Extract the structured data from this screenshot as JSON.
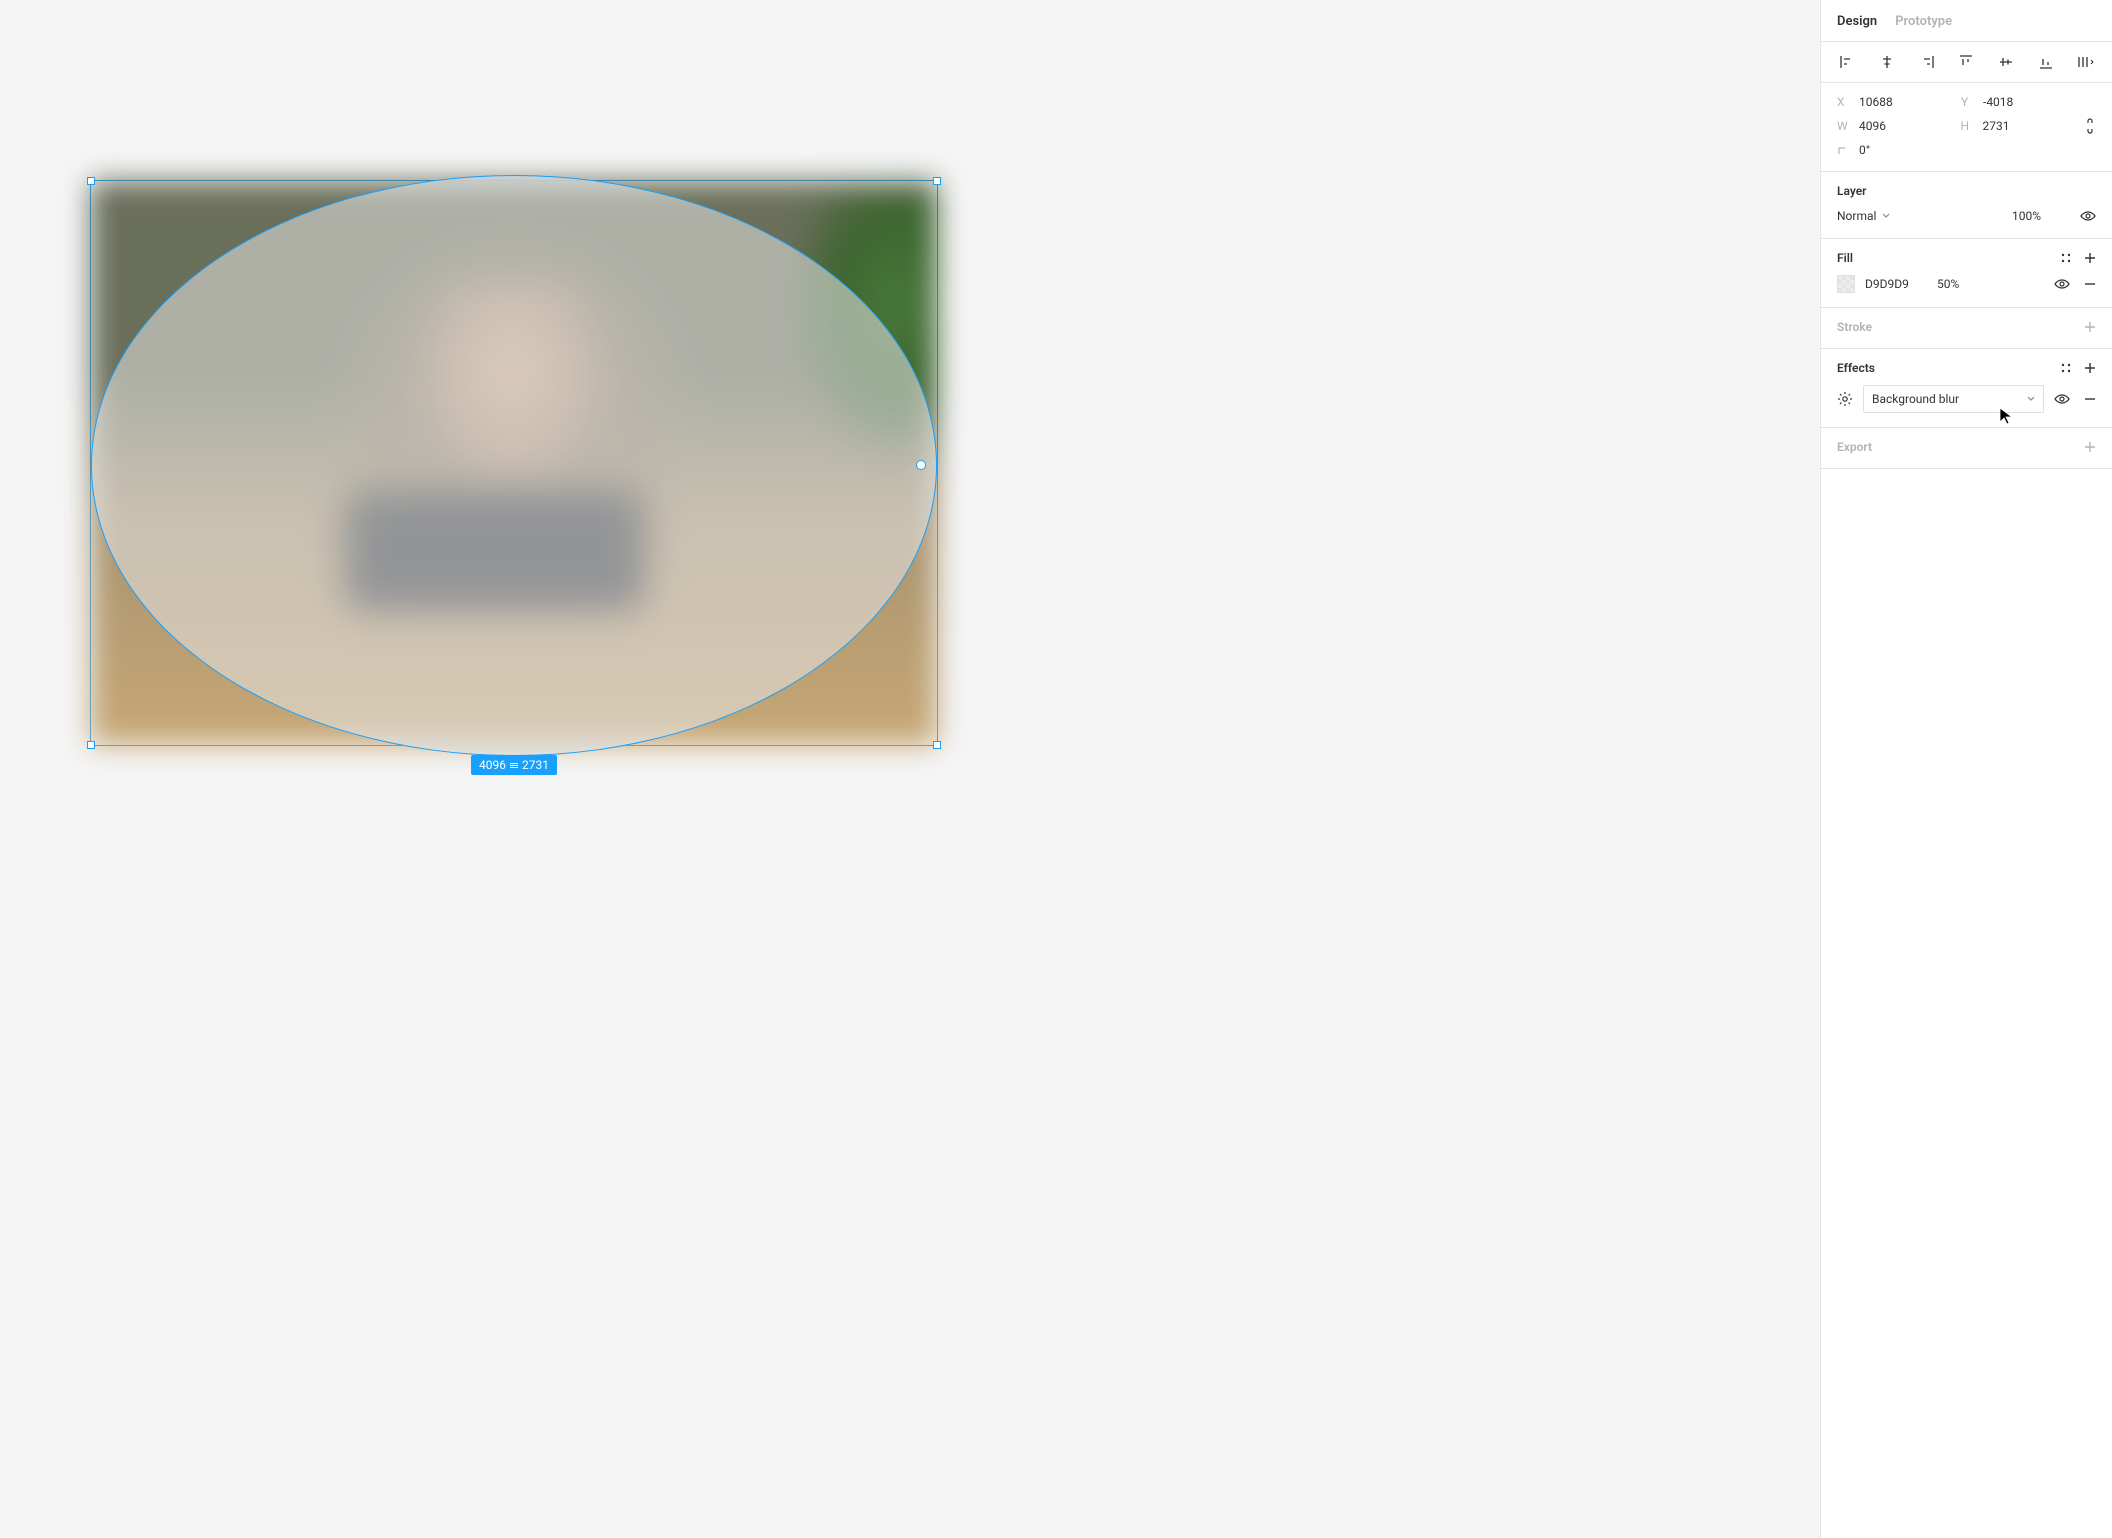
{
  "tabs": {
    "design": "Design",
    "prototype": "Prototype"
  },
  "transform": {
    "x_label": "X",
    "x": "10688",
    "y_label": "Y",
    "y": "-4018",
    "w_label": "W",
    "w": "4096",
    "h_label": "H",
    "h": "2731",
    "rotation": "0°"
  },
  "size_badge": {
    "w": "4096",
    "h": "2731"
  },
  "layer": {
    "title": "Layer",
    "blend_mode": "Normal",
    "opacity": "100%"
  },
  "fill": {
    "title": "Fill",
    "hex": "D9D9D9",
    "opacity": "50%"
  },
  "stroke": {
    "title": "Stroke"
  },
  "effects": {
    "title": "Effects",
    "selected": "Background blur"
  },
  "export": {
    "title": "Export"
  }
}
